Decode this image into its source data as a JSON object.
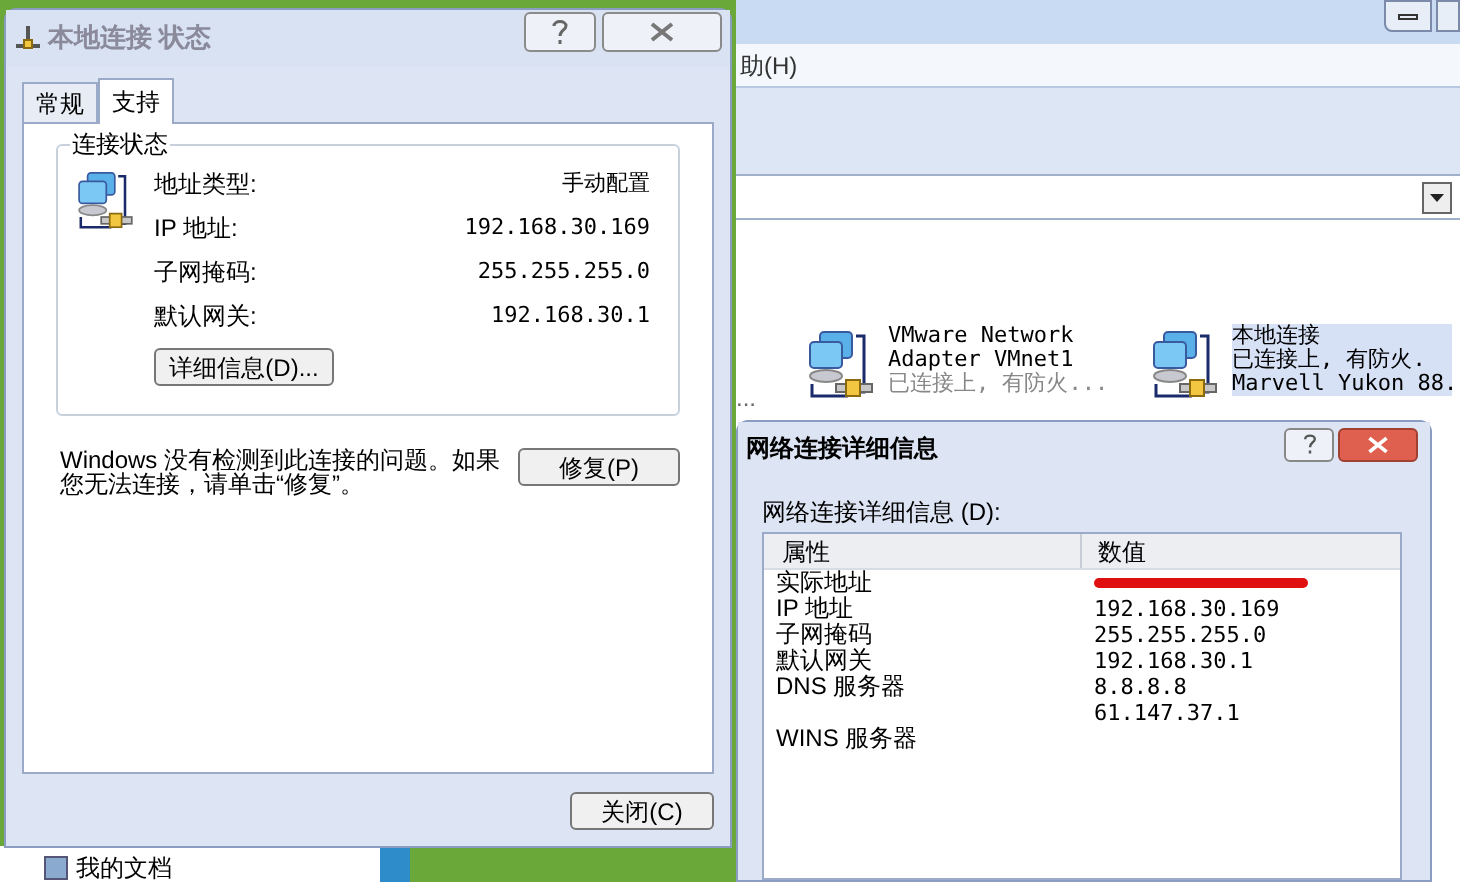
{
  "background_window": {
    "menu_text": "助(H)",
    "left_text": "...",
    "connections": [
      {
        "name": "VMware Network Adapter VMnet1",
        "status": "已连接上, 有防火...",
        "selected": false
      },
      {
        "name": "本地连接",
        "status": "已连接上, 有防火.",
        "device": "Marvell Yukon 88.",
        "selected": true
      }
    ],
    "task_items": [
      "我的文档"
    ]
  },
  "status_dialog": {
    "title": "本地连接 状态",
    "tabs": [
      {
        "label": "常规",
        "selected": false
      },
      {
        "label": "支持",
        "selected": true
      }
    ],
    "group_title": "连接状态",
    "fields": [
      {
        "label": "地址类型:",
        "value": "手动配置"
      },
      {
        "label": "IP 地址:",
        "value": "192.168.30.169"
      },
      {
        "label": "子网掩码:",
        "value": "255.255.255.0"
      },
      {
        "label": "默认网关:",
        "value": "192.168.30.1"
      }
    ],
    "details_button": "详细信息(D)...",
    "message": "Windows 没有检测到此连接的问题。如果您无法连接，请单击“修复”。",
    "repair_button": "修复(P)",
    "close_button": "关闭(C)"
  },
  "details_dialog": {
    "title": "网络连接详细信息",
    "list_label": "网络连接详细信息 (D):",
    "columns": [
      "属性",
      "数值"
    ],
    "rows": [
      {
        "property": "实际地址",
        "redacted": true
      },
      {
        "property": "IP 地址",
        "value": "192.168.30.169"
      },
      {
        "property": "子网掩码",
        "value": "255.255.255.0"
      },
      {
        "property": "默认网关",
        "value": "192.168.30.1"
      },
      {
        "property": "DNS 服务器",
        "value": "8.8.8.8"
      },
      {
        "value": "61.147.37.1"
      },
      {
        "property": "WINS 服务器"
      }
    ]
  }
}
